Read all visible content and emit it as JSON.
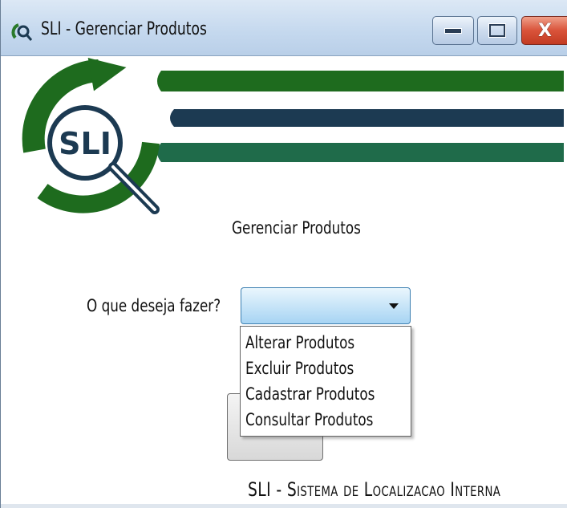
{
  "window": {
    "title": "SLI - Gerenciar Produtos",
    "icon": "sli-app-icon",
    "controls": [
      "minimize-icon",
      "maximize-icon",
      "close-icon"
    ],
    "close_glyph": "X"
  },
  "logo": {
    "text": "SLI",
    "colors": {
      "dark_green": "#1e6b1e",
      "navy": "#1c3a52",
      "teal_green": "#1f6b4a"
    }
  },
  "main": {
    "heading": "Gerenciar Produtos",
    "prompt_label": "O que deseja fazer?",
    "combo": {
      "value": ""
    },
    "dropdown_options": [
      "Alterar Produtos",
      "Excluir Produtos",
      "Cadastrar Produtos",
      "Consultar Produtos"
    ],
    "action_button_label": ""
  },
  "footer": {
    "text": "SLI - Sistema de Localizacao Interna"
  },
  "colors": {
    "combo_border": "#3c7fb1",
    "titlebar": "#c4d8ee",
    "close_button": "#d9533a"
  }
}
